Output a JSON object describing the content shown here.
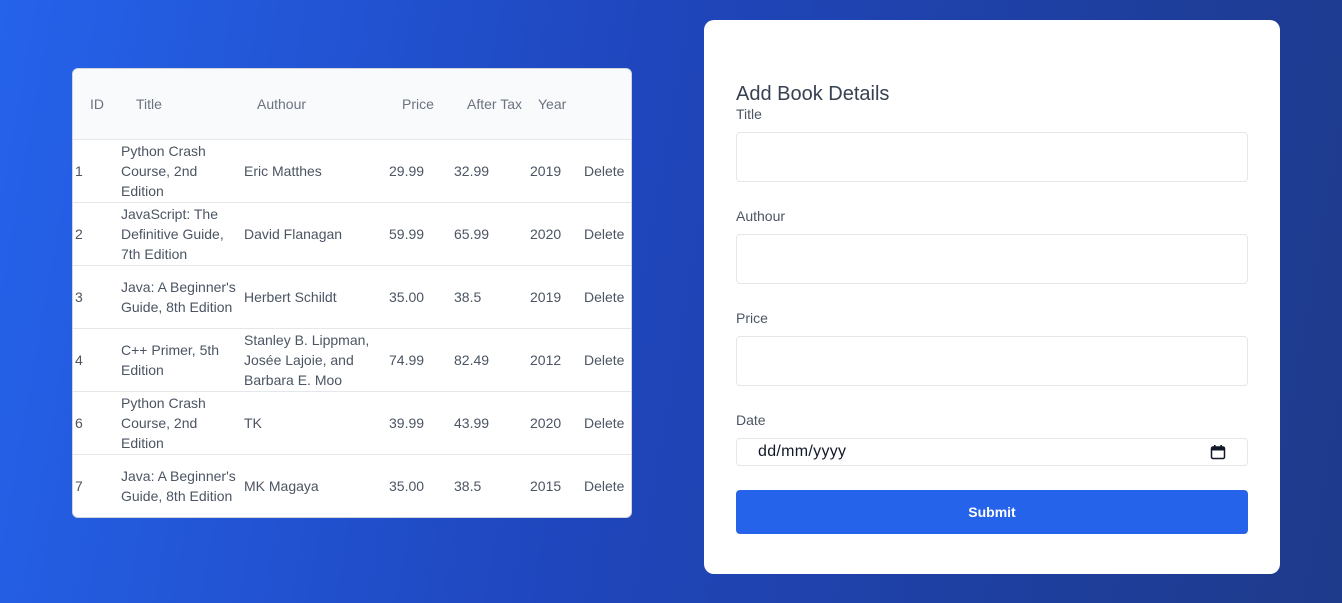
{
  "table": {
    "headers": {
      "id": "ID",
      "title": "Title",
      "author": "Authour",
      "price": "Price",
      "after_tax": "After Tax",
      "year": "Year"
    },
    "rows": [
      {
        "id": "1",
        "title": "Python Crash Course, 2nd Edition",
        "author": "Eric Matthes",
        "price": "29.99",
        "after_tax": "32.99",
        "year": "2019",
        "action": "Delete"
      },
      {
        "id": "2",
        "title": "JavaScript: The Definitive Guide, 7th Edition",
        "author": "David Flanagan",
        "price": "59.99",
        "after_tax": "65.99",
        "year": "2020",
        "action": "Delete"
      },
      {
        "id": "3",
        "title": "Java: A Beginner's Guide, 8th Edition",
        "author": "Herbert Schildt",
        "price": "35.00",
        "after_tax": "38.5",
        "year": "2019",
        "action": "Delete"
      },
      {
        "id": "4",
        "title": "C++ Primer, 5th Edition",
        "author": "Stanley B. Lippman, Josée Lajoie, and Barbara E. Moo",
        "price": "74.99",
        "after_tax": "82.49",
        "year": "2012",
        "action": "Delete"
      },
      {
        "id": "6",
        "title": "Python Crash Course, 2nd Edition",
        "author": "TK",
        "price": "39.99",
        "after_tax": "43.99",
        "year": "2020",
        "action": "Delete"
      },
      {
        "id": "7",
        "title": "Java: A Beginner's Guide, 8th Edition",
        "author": "MK Magaya",
        "price": "35.00",
        "after_tax": "38.5",
        "year": "2015",
        "action": "Delete"
      }
    ]
  },
  "form": {
    "heading": "Add Book Details",
    "title_label": "Title",
    "title_value": "",
    "author_label": "Authour",
    "author_value": "",
    "price_label": "Price",
    "price_value": "",
    "date_label": "Date",
    "date_placeholder": "dd/mm/yyyy",
    "submit_label": "Submit"
  },
  "colors": {
    "accent": "#2563eb",
    "background_start": "#2563eb",
    "background_end": "#1e3a8a"
  },
  "icons": {
    "date_picker": "calendar-icon"
  }
}
